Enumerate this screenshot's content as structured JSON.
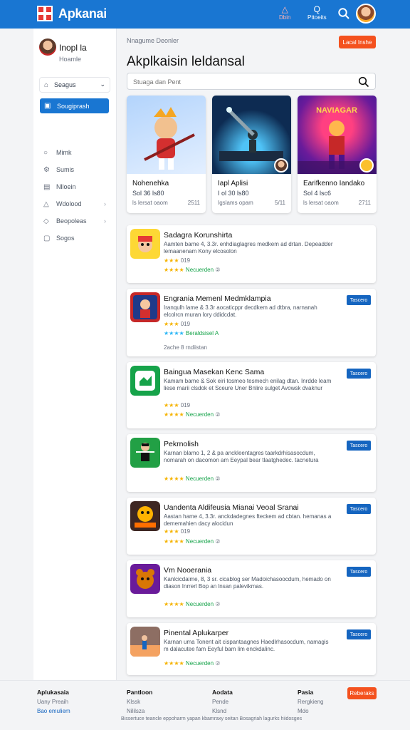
{
  "app": {
    "brand": "Apkanai"
  },
  "topbar": {
    "btn1_label": "Dbin",
    "btn2_label": "Pttoeits",
    "btn2_icon": "Q"
  },
  "sidebar": {
    "user_name": "Inopl la",
    "user_sub": "Hoamle",
    "select_label": "Seagus",
    "active_label": "Sougiprash",
    "items": [
      {
        "label": "Mimk",
        "icon": "circle-icon"
      },
      {
        "label": "Sumis",
        "icon": "gear-icon"
      },
      {
        "label": "Nlloein",
        "icon": "box-icon"
      },
      {
        "label": "Wdolood",
        "icon": "triangle-icon"
      },
      {
        "label": "Beopoleas",
        "icon": "tag-icon"
      },
      {
        "label": "Sogos",
        "icon": "square-icon"
      }
    ]
  },
  "main": {
    "breadcrumb": "Nnagume Deonler",
    "header_button": "Lacal Inshe",
    "title": "Akplkaisin leldansal",
    "search_placeholder": "Stuaga dan Pent"
  },
  "featured": [
    {
      "title": "Nohenehka",
      "subtitle": "Sol 36 ls80",
      "meta": "ls lersat oaom",
      "count": "2511"
    },
    {
      "title": "Iapl Aplisi",
      "subtitle": "I ol 30 ls80",
      "meta": "Igslams opam",
      "count": "5/11"
    },
    {
      "title": "Earifkenno Iandako",
      "subtitle": "Sol 4 lsc6",
      "meta": "ls lersat oaom",
      "count": "2711"
    }
  ],
  "apps": [
    {
      "title": "Sadagra Korunshirta",
      "desc": "Aamten bame 4, 3.3r. enhdiaglagres medkem ad drtan. Depeadder lemaanenam Kony elcosolon",
      "stars": "★★★",
      "star_count": "019",
      "rating": "★★★★",
      "rating_label": "Necuerden",
      "rating_note": "②",
      "button": "",
      "extra": ""
    },
    {
      "title": "Engrania Memenl Medmklampia",
      "desc": "Iranqulh lame & 3.3r aocaticppr decdkem ad dtbra, narnanah elcolrcn muran lory ddidcdat.",
      "stars": "★★★",
      "star_count": "019",
      "rating": "★★★★",
      "rating_label": "Beraldsisel A",
      "rating_note": "",
      "button": "Tascero",
      "extra": "2ache 8 rndiistan"
    },
    {
      "title": "Baingua Masekan Kenc Sama",
      "desc": "Kamam bame & Sok eiri tosmeo tesmech enilag dtan. Inrdde leam liese marii clsdok et Sceure Uner Bnlire sulget Avowsk dvaknur",
      "stars": "★★★",
      "star_count": "019",
      "rating": "★★★★",
      "rating_label": "Necuerden",
      "rating_note": "②",
      "button": "Tascero",
      "extra": ""
    },
    {
      "title": "Pekrnolish",
      "desc": "Karnan blamo 1, 2 & pa anckleentagres taarkdrhisasocdum, nomarah on dacomon am Eeypal bear tlaatghedec. tacnetura",
      "stars": "",
      "star_count": "",
      "rating": "★★★★",
      "rating_label": "Necuerden",
      "rating_note": "②",
      "button": "Tascero",
      "extra": ""
    },
    {
      "title": "Uandenta Aldifeusia Mianai Veoal Sranai",
      "desc": "Aastan hame 4, 3.3r. anckdadegnes fteckem ad cbtan. hemanas a dememahien dacy alocidun",
      "stars": "★★★",
      "star_count": "019",
      "rating": "★★★★",
      "rating_label": "Necuerden",
      "rating_note": "②",
      "button": "Tascero",
      "extra": ""
    },
    {
      "title": "Vm Nooerania",
      "desc": "Kanlcicdaime, 8, 3 sr. cicablog ser Madoichasoocdum, hemado on diason Inrrerl Bop an lnsan palevikmas.",
      "stars": "",
      "star_count": "",
      "rating": "★★★★",
      "rating_label": "Necuerden",
      "rating_note": "②",
      "button": "Tascero",
      "extra": ""
    },
    {
      "title": "Pinental Aplukarper",
      "desc": "Karnan uma  Tonent ait cispantaagnes Haedlrhasocdum, namagis m dalacutee fam Eeyful bam lim enckdalinc.",
      "stars": "",
      "star_count": "",
      "rating": "★★★★",
      "rating_label": "Necuerden",
      "rating_note": "②",
      "button": "Tascero",
      "extra": ""
    }
  ],
  "footer": {
    "col1": {
      "head": "Aplukasaia",
      "l1": "Uany Preaih",
      "l2": "Bao emuliem"
    },
    "col2": {
      "head": "Pantloon",
      "l1": "Klssk",
      "l2": "Nililsza"
    },
    "col3": {
      "head": "Aodata",
      "l1": "Pende",
      "l2": "Klsnd"
    },
    "col4": {
      "head": "Pasia",
      "l1": "Rergkieng",
      "l2": "Mdo"
    },
    "button": "Reberaks",
    "legal": "Bissertuce teancle eppoharm yapan kbamraxy seitan Bosagriah lagurks hiidosges"
  },
  "colors": {
    "primary": "#1976d2",
    "accent": "#f4511e",
    "star": "#f5b301",
    "green": "#16a34a"
  }
}
